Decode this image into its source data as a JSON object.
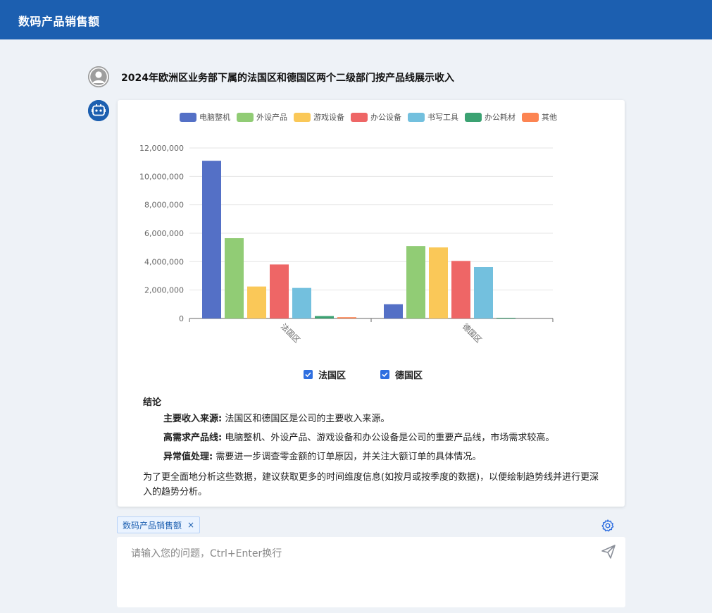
{
  "app": {
    "title": "数码产品销售额"
  },
  "conversation": {
    "question": "2024年欧洲区业务部下属的法国区和德国区两个二级部门按产品线展示收入"
  },
  "chart_data": {
    "type": "bar",
    "categories": [
      "法国区",
      "德国区"
    ],
    "series": [
      {
        "name": "电脑整机",
        "color": "#5470c6",
        "values": [
          11100000,
          1000000
        ]
      },
      {
        "name": "外设产品",
        "color": "#91cc75",
        "values": [
          5650000,
          5100000
        ]
      },
      {
        "name": "游戏设备",
        "color": "#fac858",
        "values": [
          2250000,
          5000000
        ]
      },
      {
        "name": "办公设备",
        "color": "#ee6666",
        "values": [
          3800000,
          4050000
        ]
      },
      {
        "name": "书写工具",
        "color": "#73c0de",
        "values": [
          2150000,
          3620000
        ]
      },
      {
        "name": "办公耗材",
        "color": "#3ba272",
        "values": [
          170000,
          30000
        ]
      },
      {
        "name": "其他",
        "color": "#fc8452",
        "values": [
          90000,
          0
        ]
      }
    ],
    "ylim": [
      0,
      12000000
    ],
    "yticks": [
      "0",
      "2,000,000",
      "4,000,000",
      "6,000,000",
      "8,000,000",
      "10,000,000",
      "12,000,000"
    ],
    "legend_position": "top",
    "grid": true
  },
  "series_toggles": [
    {
      "label": "法国区",
      "checked": true
    },
    {
      "label": "德国区",
      "checked": true
    }
  ],
  "conclusion": {
    "heading": "结论",
    "points": [
      {
        "label": "主要收入来源:",
        "text": " 法国区和德国区是公司的主要收入来源。"
      },
      {
        "label": "高需求产品线:",
        "text": " 电脑整机、外设产品、游戏设备和办公设备是公司的重要产品线，市场需求较高。"
      },
      {
        "label": "异常值处理:",
        "text": " 需要进一步调查零金额的订单原因，并关注大额订单的具体情况。"
      }
    ],
    "summary": "为了更全面地分析这些数据，建议获取更多的时间维度信息(如按月或按季度的数据)，以便绘制趋势线并进行更深入的趋势分析。"
  },
  "context_tag": {
    "label": "数码产品销售额",
    "close": "×"
  },
  "input": {
    "placeholder": "请输入您的问题，Ctrl+Enter换行",
    "value": ""
  },
  "icons": {
    "settings": "gear-icon",
    "send": "send-icon",
    "user_avatar": "user-avatar-icon",
    "bot_avatar": "robot-icon"
  }
}
